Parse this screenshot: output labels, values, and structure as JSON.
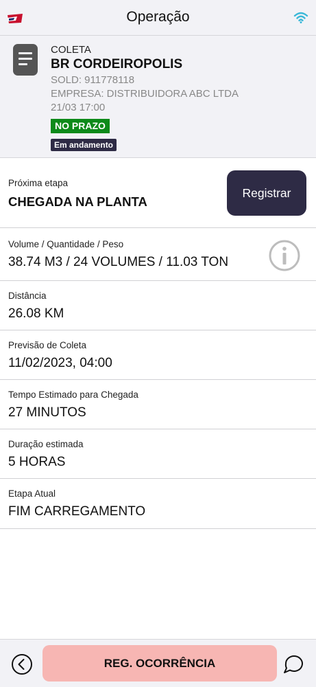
{
  "topbar": {
    "title": "Operação",
    "logo_icon": "truck-logo-icon",
    "status_icon": "wifi-icon",
    "accent_color": "#3ab8d8"
  },
  "header": {
    "icon": "document-icon",
    "type": "COLETA",
    "name": "BR CORDEIROPOLIS",
    "sold": "SOLD: 911778118",
    "company": "EMPRESA: DISTRIBUIDORA ABC LTDA",
    "datetime": "21/03 17:00",
    "deadline_badge": "NO PRAZO",
    "status_badge": "Em andamento",
    "deadline_color": "#0d8a1a",
    "status_color": "#2e2b45"
  },
  "next_step": {
    "label": "Próxima etapa",
    "value": "CHEGADA NA PLANTA",
    "button_label": "Registrar"
  },
  "volume": {
    "label": "Volume / Quantidade / Peso",
    "value": "38.74 M3 / 24 VOLUMES / 11.03 TON",
    "icon": "info-icon"
  },
  "distance": {
    "label": "Distância",
    "value": "26.08 KM"
  },
  "pickup_forecast": {
    "label": "Previsão de Coleta",
    "value": "11/02/2023, 04:00"
  },
  "eta": {
    "label": "Tempo Estimado para Chegada",
    "value": "27 MINUTOS"
  },
  "duration": {
    "label": "Duração estimada",
    "value": "5 HORAS"
  },
  "current_step": {
    "label": "Etapa Atual",
    "value": "FIM CARREGAMENTO"
  },
  "bottombar": {
    "back_icon": "chevron-left-circle-icon",
    "occurrence_label": "REG. OCORRÊNCIA",
    "chat_icon": "chat-bubble-icon",
    "occurrence_color": "#f7b6b3"
  }
}
